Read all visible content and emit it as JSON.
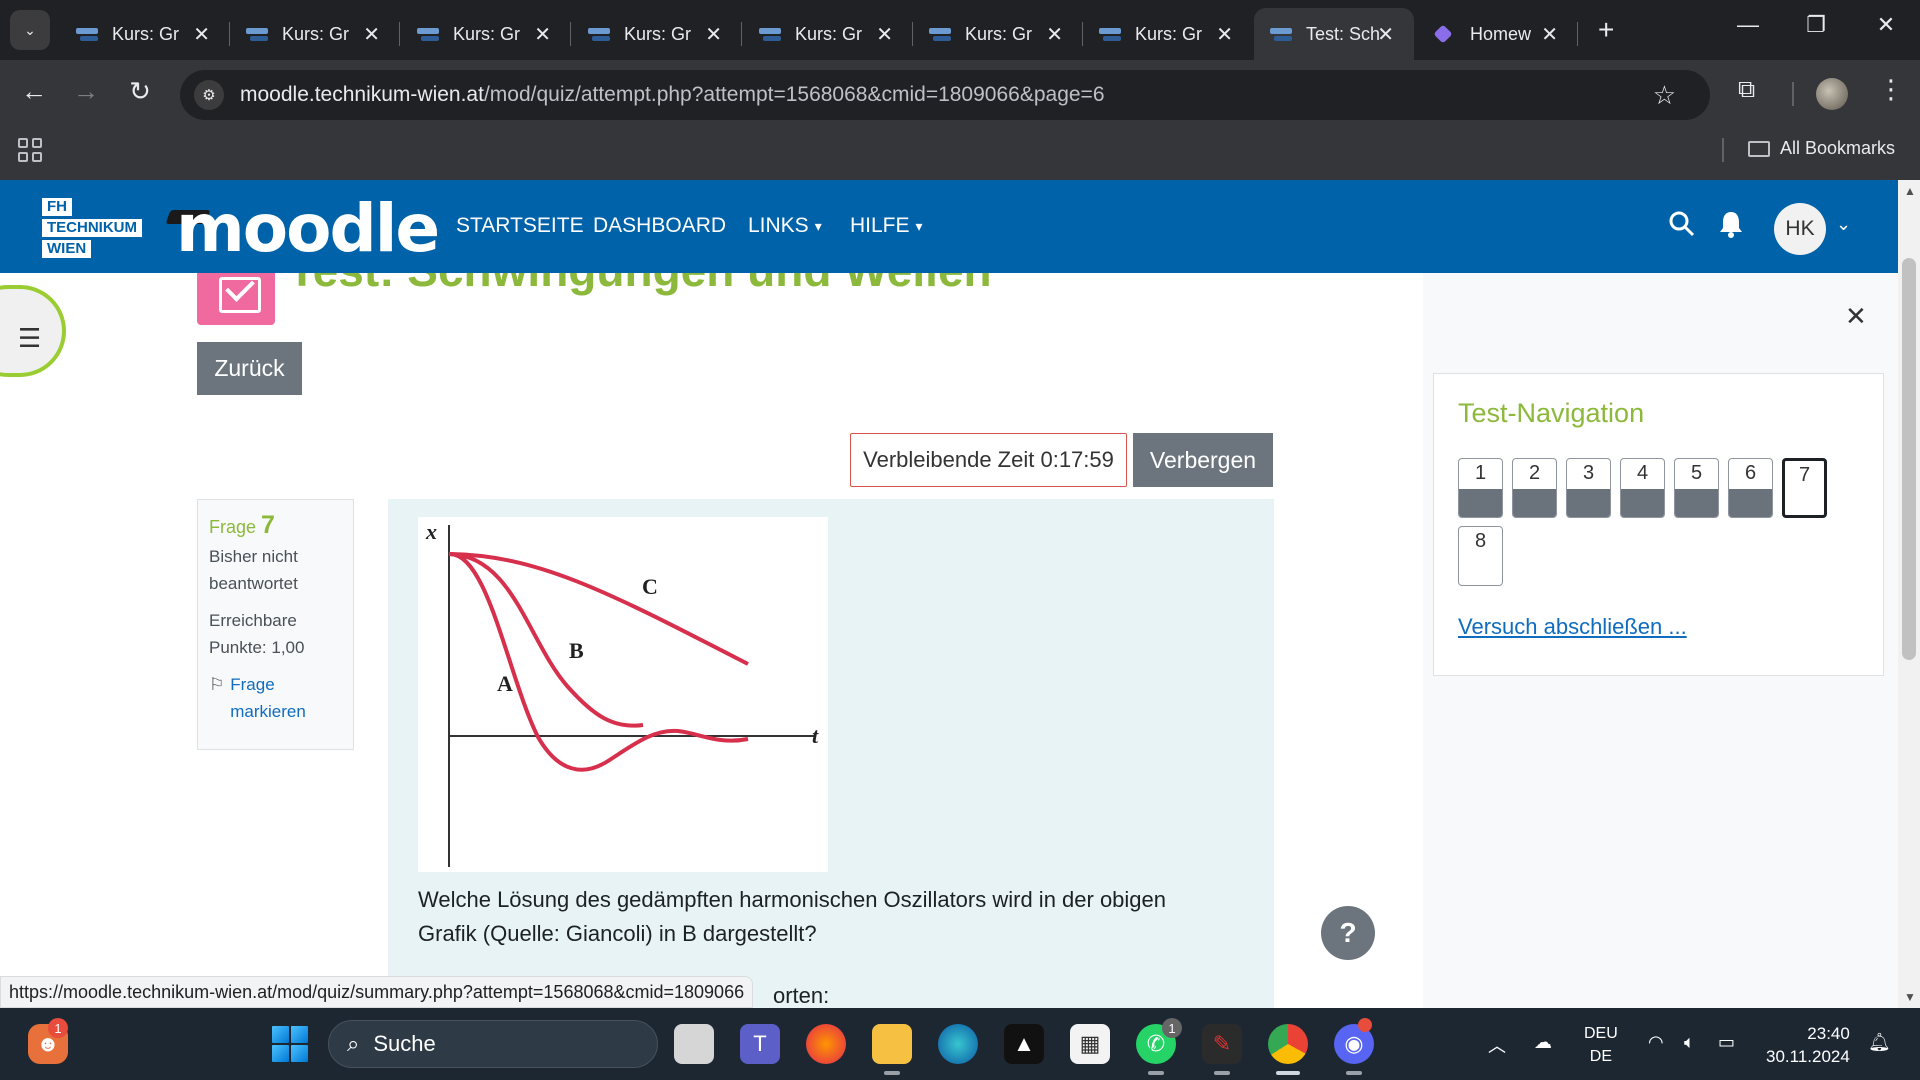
{
  "browser": {
    "tabs": [
      {
        "title": "Kurs: Gr",
        "active": false
      },
      {
        "title": "Kurs: Gr",
        "active": false
      },
      {
        "title": "Kurs: Gr",
        "active": false
      },
      {
        "title": "Kurs: Gr",
        "active": false
      },
      {
        "title": "Kurs: Gr",
        "active": false
      },
      {
        "title": "Kurs: Gr",
        "active": false
      },
      {
        "title": "Kurs: Gr",
        "active": false
      },
      {
        "title": "Test: Sch",
        "active": true
      },
      {
        "title": "Homew",
        "active": false
      }
    ],
    "url_domain": "moodle.technikum-wien.at",
    "url_path": "/mod/quiz/attempt.php?attempt=1568068&cmid=1809066&page=6",
    "bookmarks_label": "All Bookmarks"
  },
  "moodle": {
    "logo_lines": [
      "FH",
      "TECHNIKUM",
      "WIEN"
    ],
    "brand": "moodle",
    "nav": {
      "home": "STARTSEITE",
      "dashboard": "DASHBOARD",
      "links": "LINKS",
      "help": "HILFE"
    },
    "user_initials": "HK"
  },
  "page": {
    "title": "Test: Schwingungen und Wellen",
    "back_button": "Zurück",
    "timer_label": "Verbleibende Zeit 0:17:59",
    "hide_button": "Verbergen"
  },
  "question": {
    "label": "Frage",
    "number": "7",
    "status": "Bisher nicht beantwortet",
    "points": "Erreichbare Punkte: 1,00",
    "flag_label": "Frage markieren",
    "text": "Welche Lösung des gedämpften harmonischen Oszillators wird in der obigen Grafik (Quelle: Giancoli) in B dargestellt?",
    "answer_hint_partial": "orten:",
    "graph": {
      "x_axis_label": "x",
      "t_axis_label": "t",
      "curve_labels": [
        "A",
        "B",
        "C"
      ]
    }
  },
  "quiz_navigation": {
    "title": "Test-Navigation",
    "questions": [
      {
        "label": "1",
        "answered": true,
        "current": false
      },
      {
        "label": "2",
        "answered": true,
        "current": false
      },
      {
        "label": "3",
        "answered": true,
        "current": false
      },
      {
        "label": "4",
        "answered": true,
        "current": false
      },
      {
        "label": "5",
        "answered": true,
        "current": false
      },
      {
        "label": "6",
        "answered": true,
        "current": false
      },
      {
        "label": "7",
        "answered": false,
        "current": true
      },
      {
        "label": "8",
        "answered": false,
        "current": false
      }
    ],
    "finish_link": "Versuch abschließen ..."
  },
  "status_bar_url": "https://moodle.technikum-wien.at/mod/quiz/summary.php?attempt=1568068&cmid=1809066",
  "taskbar": {
    "search_placeholder": "Suche",
    "language_top": "DEU",
    "language_bottom": "DE",
    "time": "23:40",
    "date": "30.11.2024",
    "badges": {
      "left_app": "1",
      "whatsapp": "1"
    }
  },
  "colors": {
    "moodle_blue": "#0062a8",
    "accent_green": "#8cb93b",
    "quiz_pink": "#f06aa0",
    "link_blue": "#0f6cbf",
    "curve_red": "#d6304d"
  }
}
